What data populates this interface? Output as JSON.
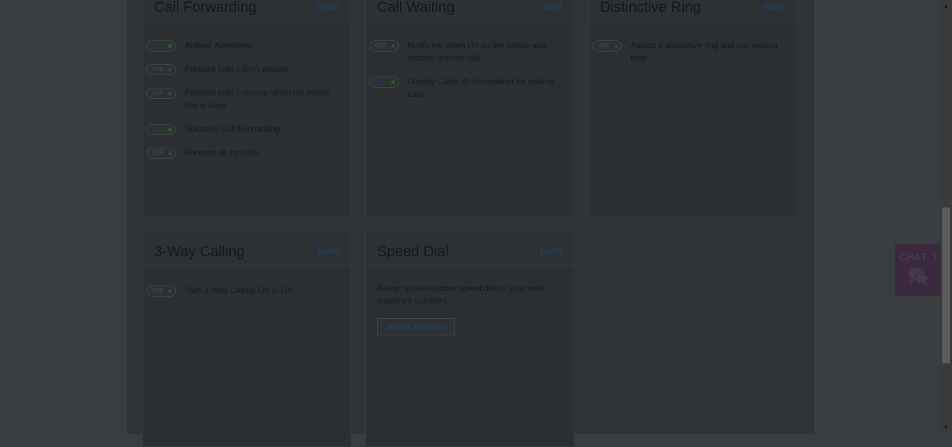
{
  "call_forwarding": {
    "title": "Call Forwarding",
    "edit": "(edit)",
    "items": [
      {
        "state": "ON",
        "label": "Answer Anywhere"
      },
      {
        "state": "OFF",
        "label": "Forward calls I don't answer"
      },
      {
        "state": "OFF",
        "label": "Forward calls I receive when my phone line is busy"
      },
      {
        "state": "ON",
        "label": "Selective Call Forwarding"
      },
      {
        "state": "OFF",
        "label": "Forward all my calls"
      }
    ]
  },
  "call_waiting": {
    "title": "Call Waiting",
    "edit": "(edit)",
    "items": [
      {
        "state": "OFF",
        "label": "Notify me when I'm on the phone and receive another call."
      },
      {
        "state": "ON",
        "label": "Display Caller ID information for waiting calls"
      }
    ]
  },
  "distinctive_ring": {
    "title": "Distinctive Ring",
    "edit": "(edit)",
    "items": [
      {
        "state": "OFF",
        "label": "Assign a distinctive ring and call waiting tone"
      }
    ]
  },
  "three_way_calling": {
    "title": "3-Way Calling",
    "edit": "(edit)",
    "items": [
      {
        "state": "OFF",
        "label": "Turn 3-Way Calling On or Off"
      }
    ]
  },
  "speed_dial": {
    "title": "Speed Dial",
    "edit": "(edit)",
    "description": "Assign a one-number speed dial to your most important numbers.",
    "button": "Add a Number"
  },
  "chat": {
    "label": "CHAT",
    "arrow_icon": "chevron-right-icon",
    "bubble_icon": "chat-bubble-icon"
  },
  "colors": {
    "overlay_bg": "#3a3d40",
    "link": "#1f3f66",
    "toggle_on_knob": "#2b5a2b",
    "chat_bg": "#3b2a3e"
  }
}
